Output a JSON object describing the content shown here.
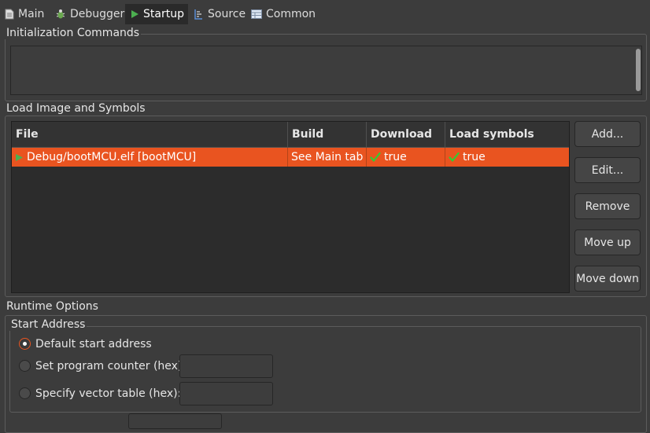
{
  "tabs": [
    {
      "label": "Main",
      "icon": "file-icon",
      "active": false
    },
    {
      "label": "Debugger",
      "icon": "bug-icon",
      "active": false
    },
    {
      "label": "Startup",
      "icon": "play-icon",
      "active": true
    },
    {
      "label": "Source",
      "icon": "source-icon",
      "active": false
    },
    {
      "label": "Common",
      "icon": "table-icon",
      "active": false
    }
  ],
  "init": {
    "title": "Initialization Commands",
    "value": ""
  },
  "load": {
    "title": "Load Image and Symbols",
    "columns": [
      "File",
      "Build",
      "Download",
      "Load symbols"
    ],
    "rows": [
      {
        "file": "Debug/bootMCU.elf [bootMCU]",
        "build": "See Main tab",
        "download": "true",
        "symbols": "true"
      }
    ],
    "buttons": {
      "add": "Add...",
      "edit": "Edit...",
      "remove": "Remove",
      "move_up": "Move up",
      "move_down": "Move down"
    }
  },
  "runtime": {
    "title": "Runtime Options",
    "start": {
      "title": "Start Address",
      "default_label": "Default start address",
      "pc_label": "Set program counter (hex):",
      "vector_label": "Specify vector table (hex):",
      "pc_value": "",
      "vector_value": ""
    }
  },
  "colors": {
    "accent": "#e95420",
    "background": "#3c3c3c",
    "table_bg": "#2c2c2c",
    "check": "#33cc33"
  }
}
